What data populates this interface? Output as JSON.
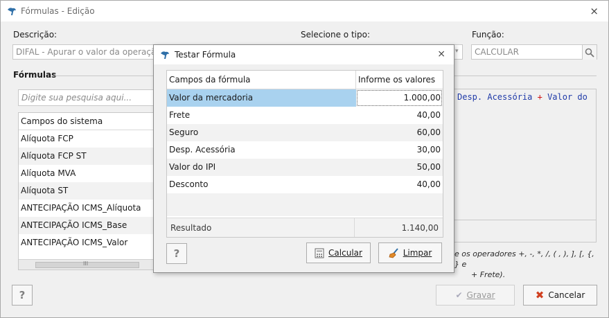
{
  "window": {
    "title": "Fórmulas - Edição",
    "close_glyph": "⨯"
  },
  "form": {
    "descricao_label": "Descrição:",
    "descricao_value": "DIFAL - Apurar o valor da operação po",
    "tipo_label": "Selecione o tipo:",
    "funcao_label": "Função:",
    "funcao_value": "CALCULAR",
    "formulas_label": "Fórmulas"
  },
  "left_panel": {
    "search_placeholder": "Digite sua pesquisa aqui...",
    "list_header": "Campos do sistema",
    "items": [
      "Alíquota FCP",
      "Alíquota FCP ST",
      "Alíquota MVA",
      "Alíquota ST",
      "ANTECIPAÇÃO ICMS_Alíquota",
      "ANTECIPAÇÃO ICMS_Base",
      "ANTECIPAÇÃO ICMS_Valor"
    ],
    "scroll_glyph": "III"
  },
  "formula_editor": {
    "part1": "Desp. Acessória",
    "op": " + ",
    "part2": "Valor do",
    "help_line1": "e os operadores +, -, *, /, ( , ), ], [, {, } e",
    "help_line2": "+ Frete)."
  },
  "footer": {
    "help_label": "?",
    "gravar_label": "Gravar",
    "cancelar_label": "Cancelar"
  },
  "dialog": {
    "title": "Testar Fórmula",
    "close_glyph": "⨯",
    "col_campos": "Campos da fórmula",
    "col_valores": "Informe os valores",
    "rows": [
      {
        "name": "Valor da mercadoria",
        "value": "1.000,00"
      },
      {
        "name": "Frete",
        "value": "40,00"
      },
      {
        "name": "Seguro",
        "value": "60,00"
      },
      {
        "name": "Desp. Acessória",
        "value": "30,00"
      },
      {
        "name": "Valor do IPI",
        "value": "50,00"
      },
      {
        "name": "Desconto",
        "value": "40,00"
      }
    ],
    "result_label": "Resultado",
    "result_value": "1.140,00",
    "help_label": "?",
    "calcular_label": "Calcular",
    "limpar_label": "Limpar"
  },
  "colors": {
    "selection": "#a9d2ef",
    "formula_text": "#1f3aa8",
    "operator": "#d01010",
    "cancel_icon": "#d04020"
  }
}
